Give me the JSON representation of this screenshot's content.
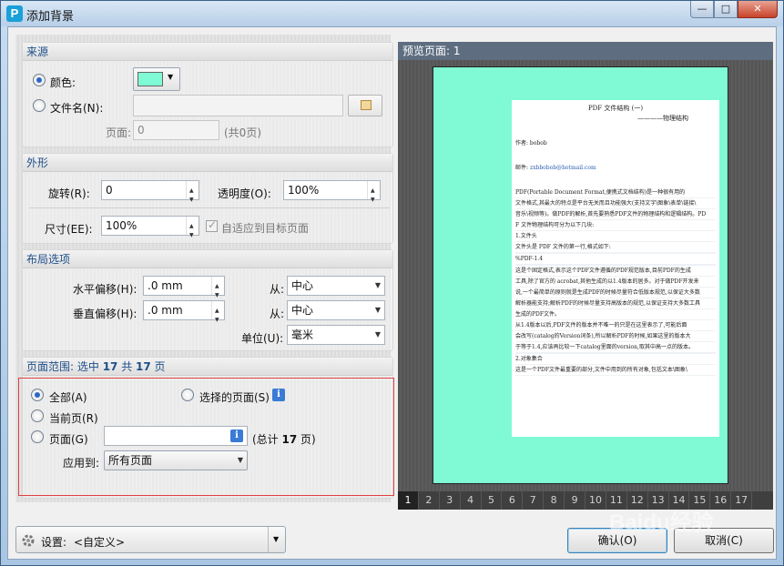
{
  "window": {
    "title": "添加背景",
    "app_icon": "P",
    "min_label": "—",
    "max_label": "□",
    "close_label": "✕"
  },
  "source": {
    "header": "来源",
    "color_label": "颜色:",
    "color_value": "#7ffad4",
    "filename_label": "文件名(N):",
    "filename_value": "",
    "page_label": "页面:",
    "page_value": "0",
    "page_total": "(共0页)"
  },
  "appearance": {
    "header": "外形",
    "rotate_label": "旋转(R):",
    "rotate_value": "0",
    "opacity_label": "透明度(O):",
    "opacity_value": "100%",
    "size_label": "尺寸(EE):",
    "size_value": "100%",
    "fit_label": "自适应到目标页面"
  },
  "layout": {
    "header": "布局选项",
    "h_offset_label": "水平偏移(H):",
    "h_offset_value": ".0 mm",
    "v_offset_label": "垂直偏移(H):",
    "v_offset_value": ".0 mm",
    "from_label": "从:",
    "h_from_value": "中心",
    "v_from_value": "中心",
    "unit_label": "单位(U):",
    "unit_value": "毫米"
  },
  "range": {
    "header_prefix": "页面范围: 选中 ",
    "selected": "17",
    "header_mid": " 共 ",
    "total": "17",
    "header_suffix": " 页",
    "all_label": "全部(A)",
    "selected_pages_label": "选择的页面(S)",
    "current_label": "当前页(R)",
    "pages_label": "页面(G)",
    "pages_value": "",
    "total_prefix": "(总计 ",
    "total_pages": "17",
    "total_suffix": " 页)",
    "apply_label": "应用到:",
    "apply_value": "所有页面"
  },
  "preview": {
    "header": "预览页面: 1",
    "doc_title": "PDF 文件结构 (一)",
    "doc_subtitle": "————物理结构",
    "author": "作者: bobob",
    "email_label": "邮件: ",
    "email": "zxbbobob@hotmail.com",
    "lines": [
      "PDF(Portable  Document  Format,便携式文档结构)是一种很有用的",
      "文件格式,其最大的特点是平台无关而且功能强大(支持文字\\图象\\表单\\链接\\",
      "音乐\\视频等)。做PDF的解析,首先要熟悉PDF文件的物理结构和逻辑结构。PD",
      "F 文件物理结构可分为以下几块:",
      "1.文件头",
      "  文件头是 PDF 文件的第一行,格式如下:",
      "",
      "  %PDF-1.4",
      "",
      "  这是个固定格式,表示这个PDF文件遵循的PDF规范版本,目前PDF的生成",
      "工具,除了官方的 acrobat,其他生成的以1.4版本的居多。对于做PDF开发来",
      "说,一个最简单的原则就是生成PDF的时候尽量符合低版本规范,以保证大多数",
      "解析器能支持;解析PDF的时候尽量支持高版本的规范,以保证支持大多数工具",
      "生成的PDF文件。",
      "  从1.4版本以后,PDF文件的版本并不唯一的只是在这里表示了,可能后面",
      "会改写(catalog的Version词条),所以解析PDF的时候,如果这里的版本大",
      "于等于1.4,应该再比较一下catalog里面的version,取其中高一点的版本。",
      "",
      "2.对象集合",
      "  这是一个PDF文件最重要的部分,文件中用到的所有对象,包括文本\\图象\\"
    ],
    "pages": [
      "1",
      "2",
      "3",
      "4",
      "5",
      "6",
      "7",
      "8",
      "9",
      "10",
      "11",
      "12",
      "13",
      "14",
      "15",
      "16",
      "17"
    ]
  },
  "footer": {
    "settings_label": "设置:",
    "settings_value": "<自定义>",
    "ok_label": "确认(O)",
    "cancel_label": "取消(C)"
  },
  "watermark": "Baidu经验"
}
